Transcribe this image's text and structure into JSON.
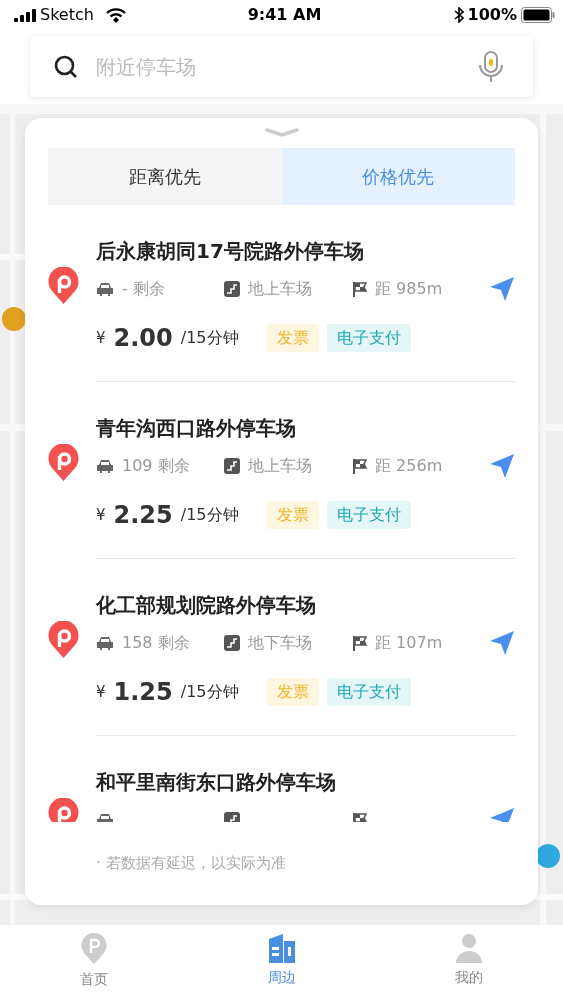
{
  "status_bar": {
    "carrier": "Sketch",
    "time": "9:41 AM",
    "battery": "100%"
  },
  "search": {
    "placeholder": "附近停车场"
  },
  "sort_tabs": [
    {
      "label": "距离优先",
      "selected": false
    },
    {
      "label": "价格优先",
      "selected": true
    }
  ],
  "parking_lots": [
    {
      "name": "后永康胡同17号院路外停车场",
      "spaces": "-  剩余",
      "type": "地上车场",
      "distance": "距 985m",
      "currency": "¥",
      "price": "2.00",
      "unit": "/15分钟",
      "tags": [
        {
          "label": "发票",
          "kind": "invoice"
        },
        {
          "label": "电子支付",
          "kind": "epay"
        }
      ]
    },
    {
      "name": "青年沟西口路外停车场",
      "spaces": "109 剩余",
      "type": "地上车场",
      "distance": "距 256m",
      "currency": "¥",
      "price": "2.25",
      "unit": "/15分钟",
      "tags": [
        {
          "label": "发票",
          "kind": "invoice"
        },
        {
          "label": "电子支付",
          "kind": "epay"
        }
      ]
    },
    {
      "name": "化工部规划院路外停车场",
      "spaces": "158 剩余",
      "type": "地下车场",
      "distance": "距 107m",
      "currency": "¥",
      "price": "1.25",
      "unit": "/15分钟",
      "tags": [
        {
          "label": "发票",
          "kind": "invoice"
        },
        {
          "label": "电子支付",
          "kind": "epay"
        }
      ]
    },
    {
      "name": "和平里南街东口路外停车场"
    }
  ],
  "notice": "· 若数据有延迟，以实际为准",
  "bottom_nav": [
    {
      "label": "首页",
      "kind": "home",
      "selected": false
    },
    {
      "label": "周边",
      "kind": "nearby",
      "selected": true
    },
    {
      "label": "我的",
      "kind": "mine",
      "selected": false
    }
  ]
}
